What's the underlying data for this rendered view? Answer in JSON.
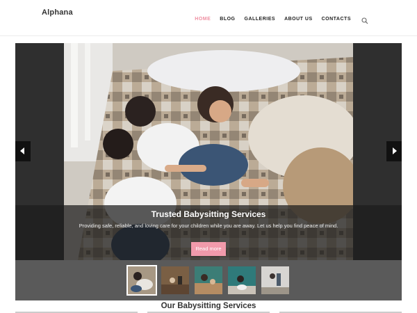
{
  "header": {
    "logo": "Alphana",
    "nav": [
      {
        "label": "HOME",
        "active": true
      },
      {
        "label": "BLOG",
        "active": false
      },
      {
        "label": "GALLERIES",
        "active": false
      },
      {
        "label": "ABOUT US",
        "active": false
      },
      {
        "label": "CONTACTS",
        "active": false
      }
    ],
    "search_icon": "search-icon"
  },
  "slider": {
    "title": "Trusted Babysitting Services",
    "text": "Providing safe, reliable, and loving care for your children while you are away. Let us help you find peace of mind.",
    "button": "Read more",
    "prev_icon": "chevron-left-icon",
    "next_icon": "chevron-right-icon",
    "thumbnails": 5,
    "active_thumbnail": 1
  },
  "section": {
    "title": "Our Babysitting Services"
  },
  "colors": {
    "accent": "#ef8fa2",
    "button": "#f19aab",
    "slider_bg": "#2f2f2f",
    "thumb_bar": "#5a5a5a"
  }
}
